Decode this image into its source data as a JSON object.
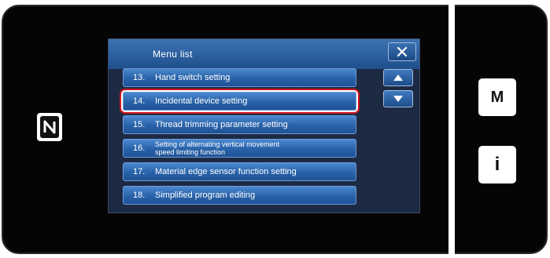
{
  "menu": {
    "title": "Menu list",
    "items": [
      {
        "num": "13.",
        "label": "Hand switch setting"
      },
      {
        "num": "14.",
        "label": "Incidental device setting"
      },
      {
        "num": "15.",
        "label": "Thread trimming parameter setting"
      },
      {
        "num": "16.",
        "label": "Setting of alternating vertical movement\nspeed limiting function"
      },
      {
        "num": "17.",
        "label": "Material edge sensor function setting"
      },
      {
        "num": "18.",
        "label": "Simplified program editing"
      }
    ],
    "selected_index": 1
  },
  "side_buttons": {
    "mode_label": "M",
    "info_label": "i"
  },
  "icons": {
    "nfc": "nfc-icon",
    "close": "close-icon",
    "up": "up-arrow-icon",
    "down": "down-arrow-icon"
  },
  "colors": {
    "header": "#2a5fa0",
    "item": "#2d67ad",
    "selection": "#d0161c"
  }
}
